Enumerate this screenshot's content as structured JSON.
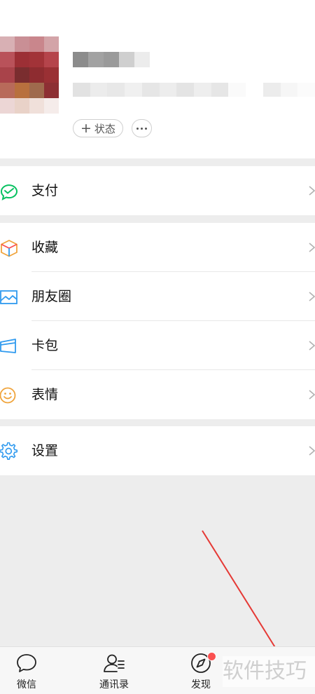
{
  "profile": {
    "status_label": "状态",
    "status_plus": "+",
    "more_label": "···"
  },
  "menu": {
    "pay": {
      "label": "支付",
      "icon": "wechat-pay-icon"
    },
    "favorites": {
      "label": "收藏",
      "icon": "cube-icon"
    },
    "moments": {
      "label": "朋友圈",
      "icon": "image-icon"
    },
    "cards": {
      "label": "卡包",
      "icon": "card-wallet-icon"
    },
    "stickers": {
      "label": "表情",
      "icon": "smiley-icon"
    },
    "settings": {
      "label": "设置",
      "icon": "gear-icon"
    }
  },
  "tabbar": {
    "chats": "微信",
    "contacts": "通讯录",
    "discover": "发现"
  },
  "watermark": "软件技巧",
  "colors": {
    "pay_green": "#07c160",
    "blue": "#2f9aef",
    "orange": "#f0a43c",
    "badge_red": "#fa5151",
    "annotation_red": "#e53935"
  }
}
